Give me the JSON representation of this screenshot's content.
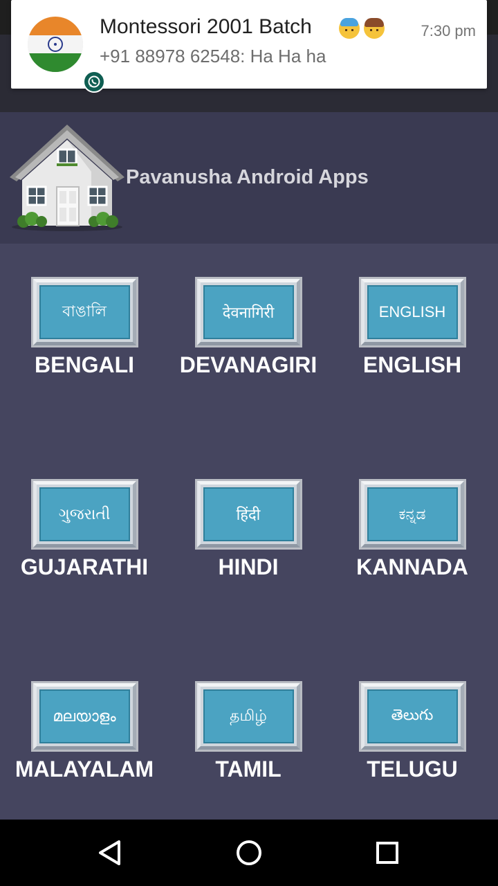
{
  "notification": {
    "title": "Montessori 2001 Batch",
    "time": "7:30 pm",
    "message": "+91 88978 62548: Ha Ha ha",
    "avatar_icon": "india-flag-avatar",
    "badge_icon": "whatsapp-icon"
  },
  "header": {
    "title": "Pavanusha Android Apps",
    "logo_icon": "house-icon"
  },
  "languages": [
    {
      "label": "BENGALI",
      "script": "বাঙালি"
    },
    {
      "label": "DEVANAGIRI",
      "script": "देवनागिरी"
    },
    {
      "label": "ENGLISH",
      "script": "ENGLISH"
    },
    {
      "label": "GUJARATHI",
      "script": "ગુજરાતી"
    },
    {
      "label": "HINDI",
      "script": "हिंदी"
    },
    {
      "label": "KANNADA",
      "script": "ಕನ್ನಡ"
    },
    {
      "label": "MALAYALAM",
      "script": "മലയാളം"
    },
    {
      "label": "TAMIL",
      "script": "தமிழ்"
    },
    {
      "label": "TELUGU",
      "script": "తెలుగు"
    }
  ],
  "nav": {
    "back_icon": "back-triangle-icon",
    "home_icon": "home-circle-icon",
    "recents_icon": "recents-square-icon"
  },
  "colors": {
    "background": "#45455f",
    "header_background": "#3a3a52",
    "tile_blue": "#4ba3c2",
    "nav_background": "#000000"
  }
}
